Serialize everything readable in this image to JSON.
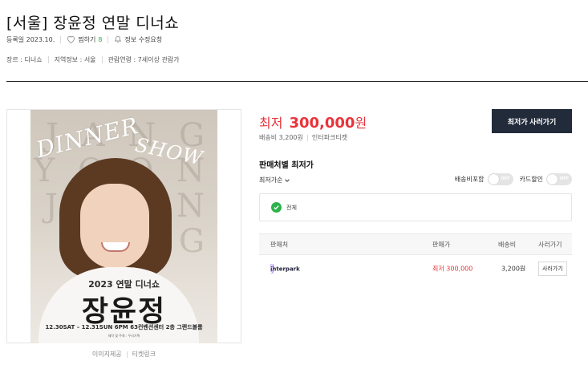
{
  "header": {
    "title": "[서울] 장윤정 연말 디너쇼",
    "registered": "등록일 2023.10.",
    "wish_label": "찜하기",
    "wish_count": "8",
    "report_label": "정보 수정요청"
  },
  "info": {
    "genre": "장르 : 디너쇼",
    "region": "지역정보 : 서울",
    "age": "관람연령 : 7세이상 관람가"
  },
  "poster": {
    "script_line1": "DINNER",
    "script_line2": "SHOW",
    "bg_letters": "J A N G Y O O N J E O N G",
    "year_title": "2023 연말 디너쇼",
    "name": "장윤정",
    "date_line": "12.30SAT – 12.31SUN 6PM  63컨벤션센터 2층 그랜드볼룸",
    "org_line": "제작 및 주최 : 우리기획",
    "links": [
      "이미지제공",
      "티켓링크"
    ]
  },
  "price": {
    "label": "최저",
    "value": "300,000",
    "unit": "원",
    "shipping": "배송비 3,200원",
    "seller": "인터파크티켓"
  },
  "buy_button": "최저가 사러가기",
  "sellers": {
    "title": "판매처별 최저가",
    "sort_label": "최저가순",
    "toggle_shipping": "배송비포함",
    "toggle_card": "카드할인",
    "toggle_state": "OFF",
    "filter_chip": "전체",
    "columns": [
      "판매처",
      "판매가",
      "배송비",
      "사러가기"
    ],
    "rows": [
      {
        "seller": "interpark",
        "seller_sub": "티켓",
        "price": "최저 300,000",
        "shipping": "3,200원",
        "action": "사러가기"
      }
    ]
  },
  "colors": {
    "accent_red": "#e8343b",
    "button_dark": "#222b3a",
    "check_green": "#2bb24c"
  }
}
